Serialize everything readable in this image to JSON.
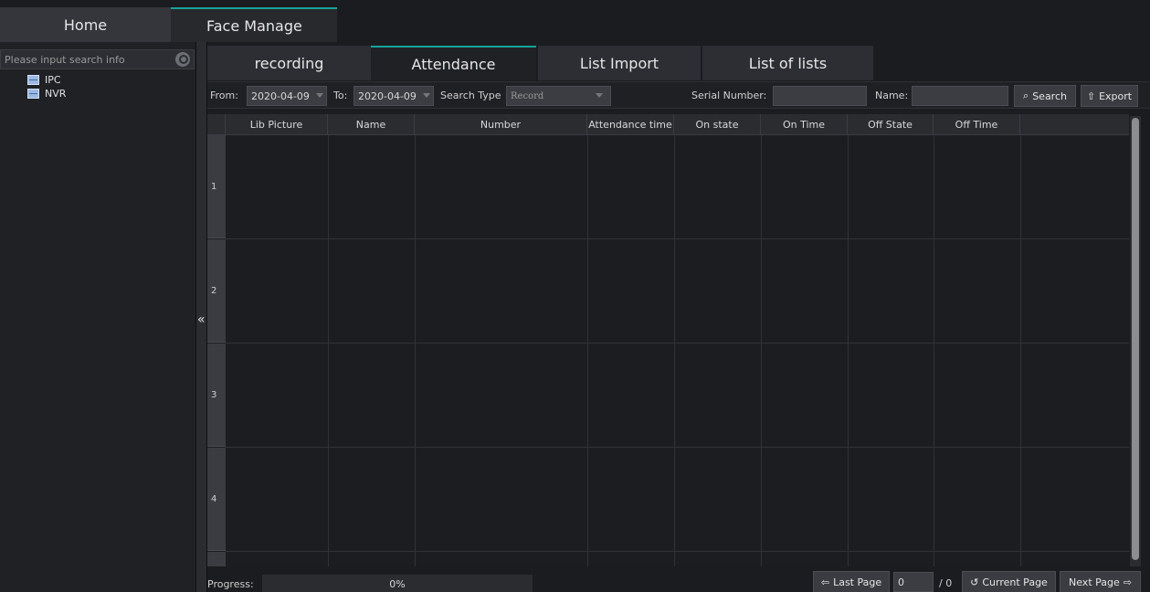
{
  "top_tabs": {
    "home": "Home",
    "face_manage": "Face Manage"
  },
  "sidebar": {
    "search_placeholder": "Please input search info",
    "items": [
      {
        "label": "IPC",
        "icon": "device-icon"
      },
      {
        "label": "NVR",
        "icon": "device-icon"
      }
    ],
    "collapse_glyph": "«"
  },
  "subtabs": [
    {
      "label": "recording",
      "active": false
    },
    {
      "label": "Attendance",
      "active": true
    },
    {
      "label": "List Import",
      "active": false
    },
    {
      "label": "List of lists",
      "active": false
    }
  ],
  "filter": {
    "from_label": "From:",
    "from_value": "2020-04-09",
    "to_label": "To:",
    "to_value": "2020-04-09",
    "search_type_label": "Search Type",
    "search_type_value": "Record",
    "serial_label": "Serial Number:",
    "serial_value": "",
    "name_label": "Name:",
    "name_value": "",
    "search_button": "Search",
    "export_button": "Export"
  },
  "table": {
    "columns": [
      "Lib Picture",
      "Name",
      "Number",
      "Attendance time",
      "On state",
      "On Time",
      "Off State",
      "Off Time"
    ],
    "rows": [
      "1",
      "2",
      "3",
      "4"
    ]
  },
  "bottom": {
    "progress_label": "Progress:",
    "progress_value": "0%",
    "last_page": "Last Page",
    "page_input": "0",
    "total_pages": "/ 0",
    "current_page": "Current Page",
    "next_page": "Next Page"
  },
  "colors": {
    "accent": "#15a39b",
    "background": "#1b1c1f"
  }
}
